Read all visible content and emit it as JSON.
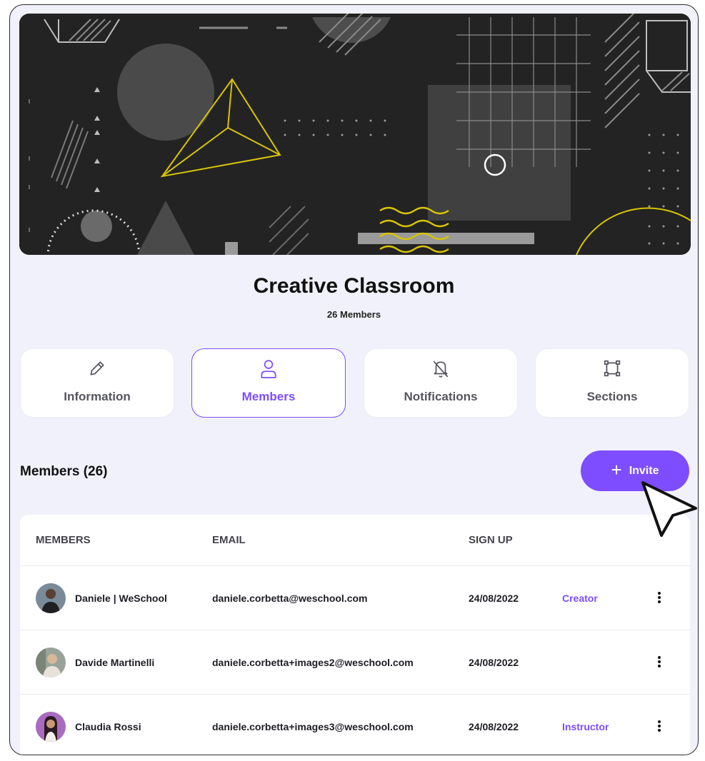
{
  "classroom": {
    "title": "Creative Classroom",
    "member_count_label": "26 Members"
  },
  "tabs": [
    {
      "label": "Information",
      "icon": "pencil-icon",
      "active": false
    },
    {
      "label": "Members",
      "icon": "user-icon",
      "active": true
    },
    {
      "label": "Notifications",
      "icon": "bell-off-icon",
      "active": false
    },
    {
      "label": "Sections",
      "icon": "sections-icon",
      "active": false
    }
  ],
  "members_section": {
    "title": "Members (26)",
    "invite_label": "Invite",
    "invite_icon": "plus-icon"
  },
  "table": {
    "headers": {
      "members": "MEMBERS",
      "email": "EMAIL",
      "signup": "SIGN UP"
    },
    "rows": [
      {
        "name": "Daniele | WeSchool",
        "email": "daniele.corbetta@weschool.com",
        "signup": "24/08/2022",
        "role": "Creator"
      },
      {
        "name": "Davide Martinelli",
        "email": "daniele.corbetta+images2@weschool.com",
        "signup": "24/08/2022",
        "role": ""
      },
      {
        "name": "Claudia Rossi",
        "email": "daniele.corbetta+images3@weschool.com",
        "signup": "24/08/2022",
        "role": "Instructor"
      }
    ]
  },
  "colors": {
    "accent": "#7d4dff",
    "page_background": "#f1f1fb",
    "banner_background": "#232323",
    "banner_highlight": "#d9c400"
  }
}
